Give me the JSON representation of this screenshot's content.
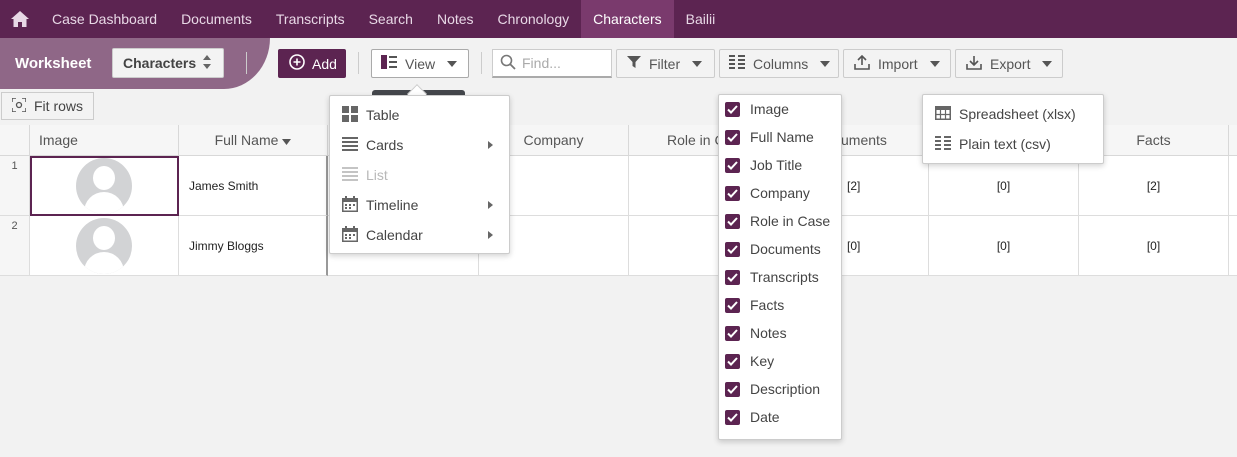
{
  "nav": {
    "items": [
      {
        "label": "Case Dashboard",
        "active": false
      },
      {
        "label": "Documents",
        "active": false
      },
      {
        "label": "Transcripts",
        "active": false
      },
      {
        "label": "Search",
        "active": false
      },
      {
        "label": "Notes",
        "active": false
      },
      {
        "label": "Chronology",
        "active": false
      },
      {
        "label": "Characters",
        "active": true
      },
      {
        "label": "Bailii",
        "active": false
      }
    ]
  },
  "toolbar": {
    "worksheet_label": "Worksheet",
    "worksheet_value": "Characters",
    "add_label": "Add",
    "view_label": "View",
    "find_placeholder": "Find...",
    "filter_label": "Filter",
    "columns_label": "Columns",
    "import_label": "Import",
    "export_label": "Export",
    "fit_rows_label": "Fit rows"
  },
  "grid": {
    "headers": {
      "image": "Image",
      "full_name": "Full Name",
      "company": "Company",
      "role": "Role in C",
      "documents": "uments",
      "facts": "Facts"
    },
    "rows": [
      {
        "num": "1",
        "name": "James Smith",
        "documents": "[2]",
        "transcripts": "[0]",
        "facts": "[2]"
      },
      {
        "num": "2",
        "name": "Jimmy Bloggs",
        "documents": "[0]",
        "transcripts": "[0]",
        "facts": "[0]"
      }
    ]
  },
  "view_menu": {
    "items": [
      {
        "label": "Table",
        "icon": "table-icon",
        "submenu": false,
        "disabled": false
      },
      {
        "label": "Cards",
        "icon": "cards-icon",
        "submenu": true,
        "disabled": false
      },
      {
        "label": "List",
        "icon": "list-icon",
        "submenu": false,
        "disabled": true
      },
      {
        "label": "Timeline",
        "icon": "calendar-icon",
        "submenu": true,
        "disabled": false
      },
      {
        "label": "Calendar",
        "icon": "calendar-icon",
        "submenu": true,
        "disabled": false
      }
    ]
  },
  "columns_menu": {
    "items": [
      {
        "label": "Image",
        "checked": true
      },
      {
        "label": "Full Name",
        "checked": true
      },
      {
        "label": "Job Title",
        "checked": true
      },
      {
        "label": "Company",
        "checked": true
      },
      {
        "label": "Role in Case",
        "checked": true
      },
      {
        "label": "Documents",
        "checked": true
      },
      {
        "label": "Transcripts",
        "checked": true
      },
      {
        "label": "Facts",
        "checked": true
      },
      {
        "label": "Notes",
        "checked": true
      },
      {
        "label": "Key",
        "checked": true
      },
      {
        "label": "Description",
        "checked": true
      },
      {
        "label": "Date",
        "checked": true
      }
    ]
  },
  "export_menu": {
    "items": [
      {
        "label": "Spreadsheet (xlsx)",
        "icon": "spreadsheet-icon"
      },
      {
        "label": "Plain text (csv)",
        "icon": "csv-icon"
      }
    ]
  },
  "colors": {
    "brand": "#5c2451",
    "nav_active": "#7a3a6d",
    "worksheet_band": "#8f6787"
  }
}
